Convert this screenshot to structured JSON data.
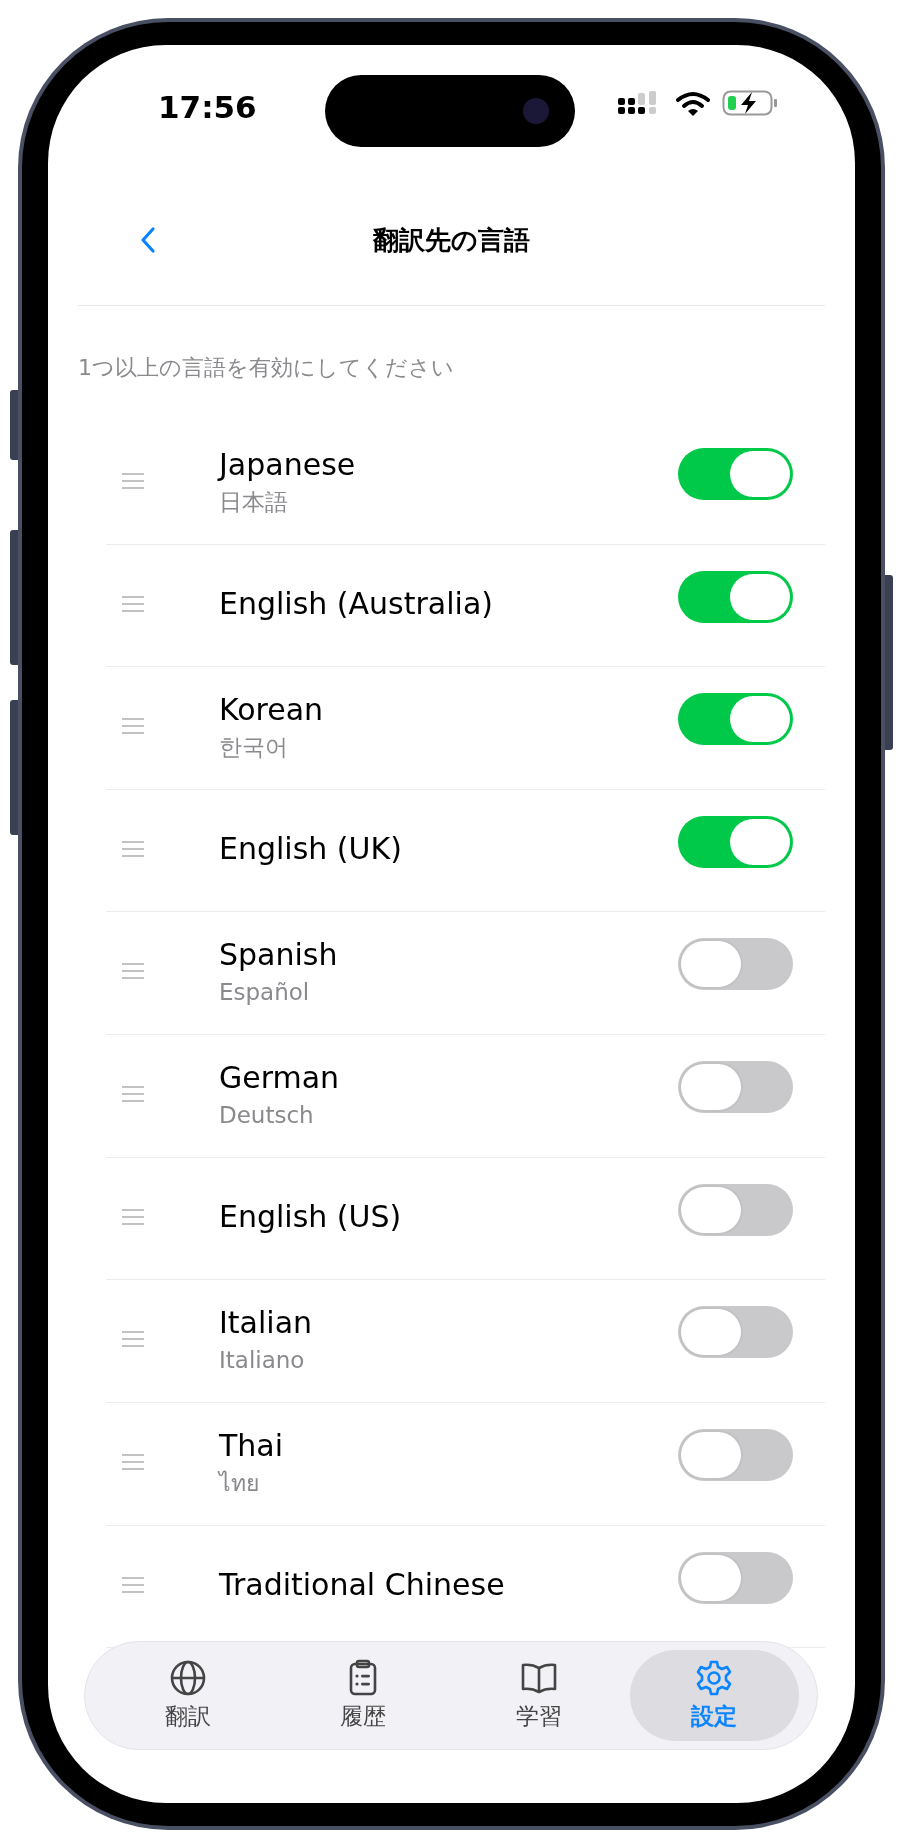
{
  "status_bar": {
    "time": "17:56"
  },
  "nav": {
    "title": "翻訳先の言語"
  },
  "hint": "1つ以上の言語を有効にしてください",
  "languages": [
    {
      "name": "Japanese",
      "native": "日本語",
      "on": true
    },
    {
      "name": "English (Australia)",
      "on": true
    },
    {
      "name": "Korean",
      "native": "한국어",
      "on": true
    },
    {
      "name": "English (UK)",
      "on": true
    },
    {
      "name": "Spanish",
      "native": "Español",
      "on": false
    },
    {
      "name": "German",
      "native": "Deutsch",
      "on": false
    },
    {
      "name": "English (US)",
      "on": false
    },
    {
      "name": "Italian",
      "native": "Italiano",
      "on": false
    },
    {
      "name": "Thai",
      "native": "ไทย",
      "on": false
    },
    {
      "name": "Traditional Chinese",
      "on": false
    }
  ],
  "tab_bar": [
    {
      "label": "翻訳",
      "kind": "globe",
      "selected": false
    },
    {
      "label": "履歴",
      "kind": "clipboard",
      "selected": false
    },
    {
      "label": "学習",
      "kind": "book",
      "selected": false
    },
    {
      "label": "設定",
      "kind": "gear",
      "selected": true
    }
  ]
}
